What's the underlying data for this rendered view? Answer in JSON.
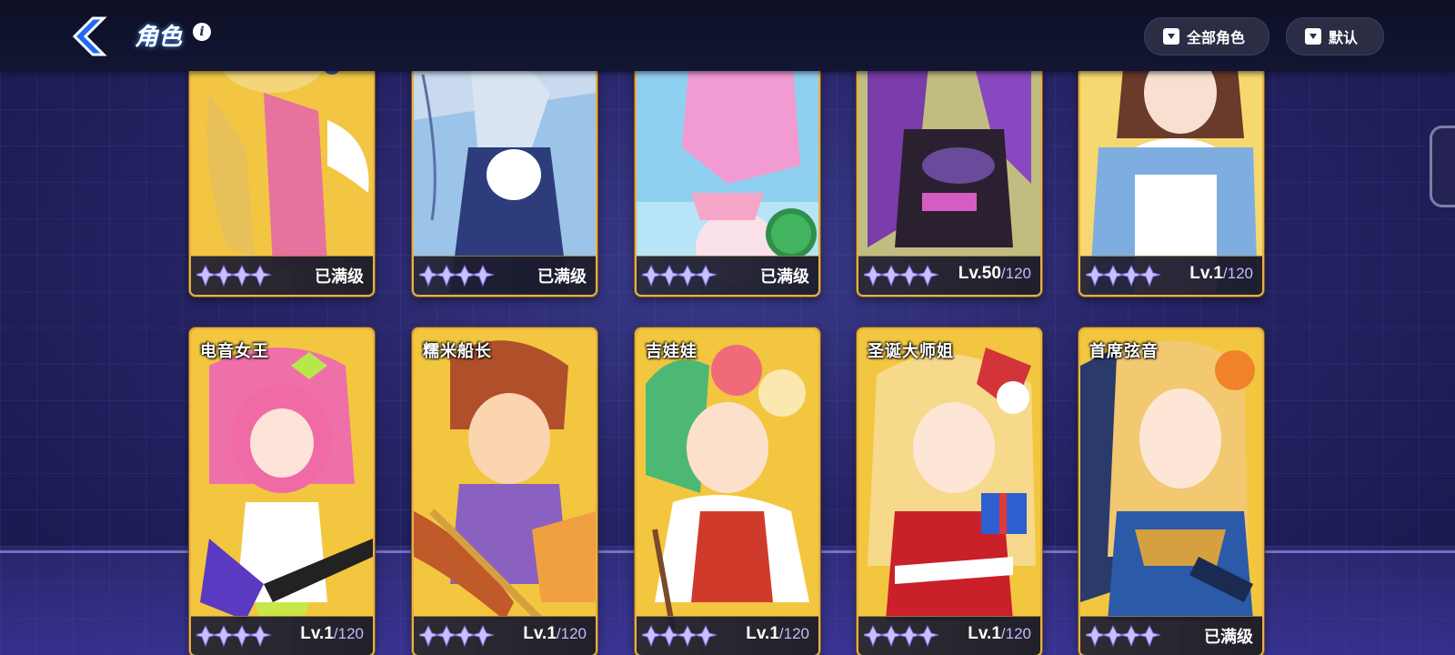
{
  "header": {
    "title": "角色",
    "info_icon": "info-icon",
    "back_icon": "back-arrow-icon",
    "filter_label": "全部角色",
    "sort_label": "默认"
  },
  "colors": {
    "card_border": "#e7b04a",
    "level_cap": "#c9b6ff",
    "header_bg": "#0c0f24"
  },
  "cards": [
    {
      "name": "",
      "status": "已满级",
      "level": "",
      "cap": ""
    },
    {
      "name": "",
      "status": "已满级",
      "level": "",
      "cap": ""
    },
    {
      "name": "",
      "status": "已满级",
      "level": "",
      "cap": ""
    },
    {
      "name": "",
      "status": "",
      "level": "Lv.50",
      "cap": "/120"
    },
    {
      "name": "",
      "status": "",
      "level": "Lv.1",
      "cap": "/120"
    },
    {
      "name": "电音女王",
      "status": "",
      "level": "Lv.1",
      "cap": "/120"
    },
    {
      "name": "糯米船长",
      "status": "",
      "level": "Lv.1",
      "cap": "/120"
    },
    {
      "name": "吉娃娃",
      "status": "",
      "level": "Lv.1",
      "cap": "/120"
    },
    {
      "name": "圣诞大师姐",
      "status": "",
      "level": "Lv.1",
      "cap": "/120"
    },
    {
      "name": "首席弦音",
      "status": "已满级",
      "level": "",
      "cap": ""
    }
  ]
}
